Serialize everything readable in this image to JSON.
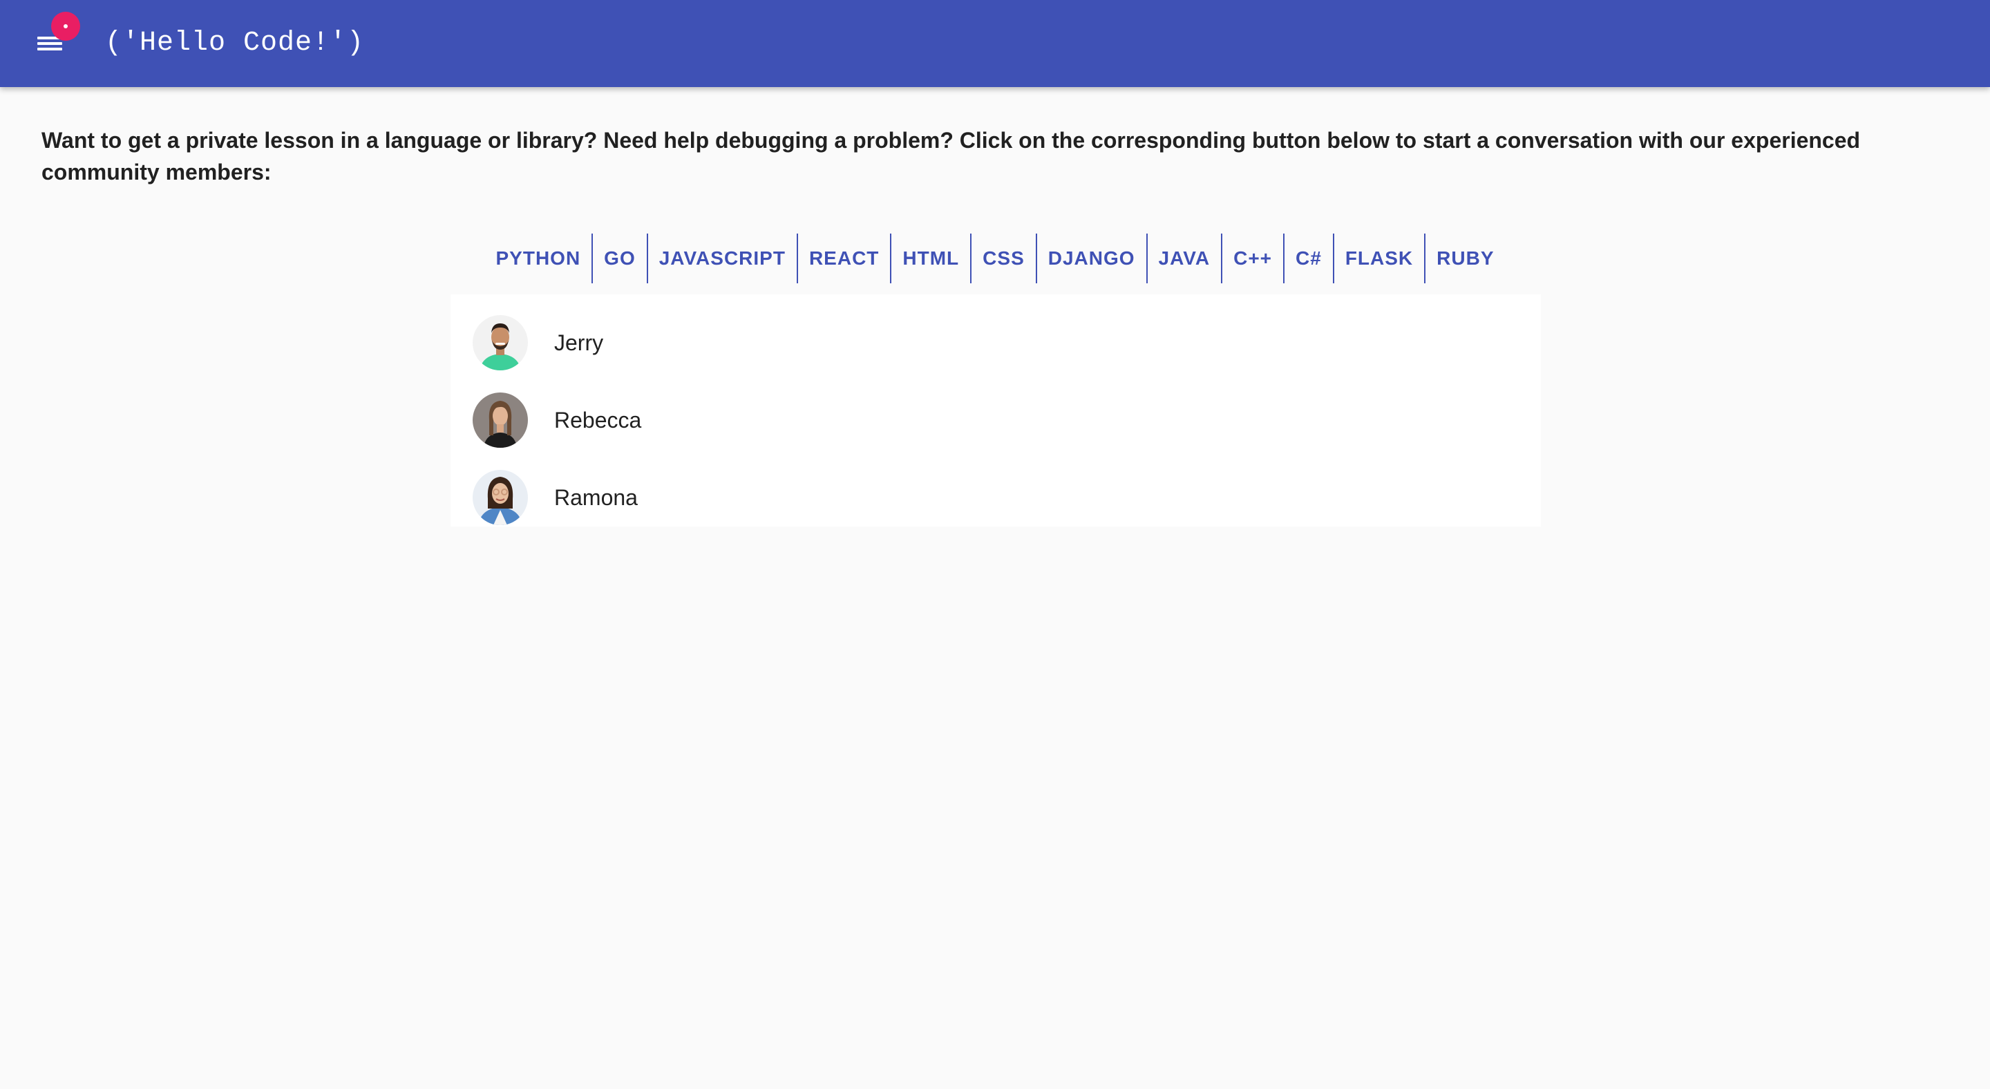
{
  "header": {
    "title": "('Hello Code!')",
    "background_color": "#3f51b5",
    "menu_icon": "hamburger-menu-icon",
    "badge_color": "#e91e63"
  },
  "intro": {
    "text": "Want to get a private lesson in a language or library? Need help debugging a problem? Click on the corresponding button below to start a conversation with our experienced community members:"
  },
  "languages": [
    "PYTHON",
    "GO",
    "JAVASCRIPT",
    "REACT",
    "HTML",
    "CSS",
    "DJANGO",
    "JAVA",
    "C++",
    "C#",
    "FLASK",
    "RUBY"
  ],
  "accent_color": "#3f51b5",
  "users": [
    {
      "name": "Jerry",
      "avatar": "jerry-avatar"
    },
    {
      "name": "Rebecca",
      "avatar": "rebecca-avatar"
    },
    {
      "name": "Ramona",
      "avatar": "ramona-avatar"
    }
  ]
}
